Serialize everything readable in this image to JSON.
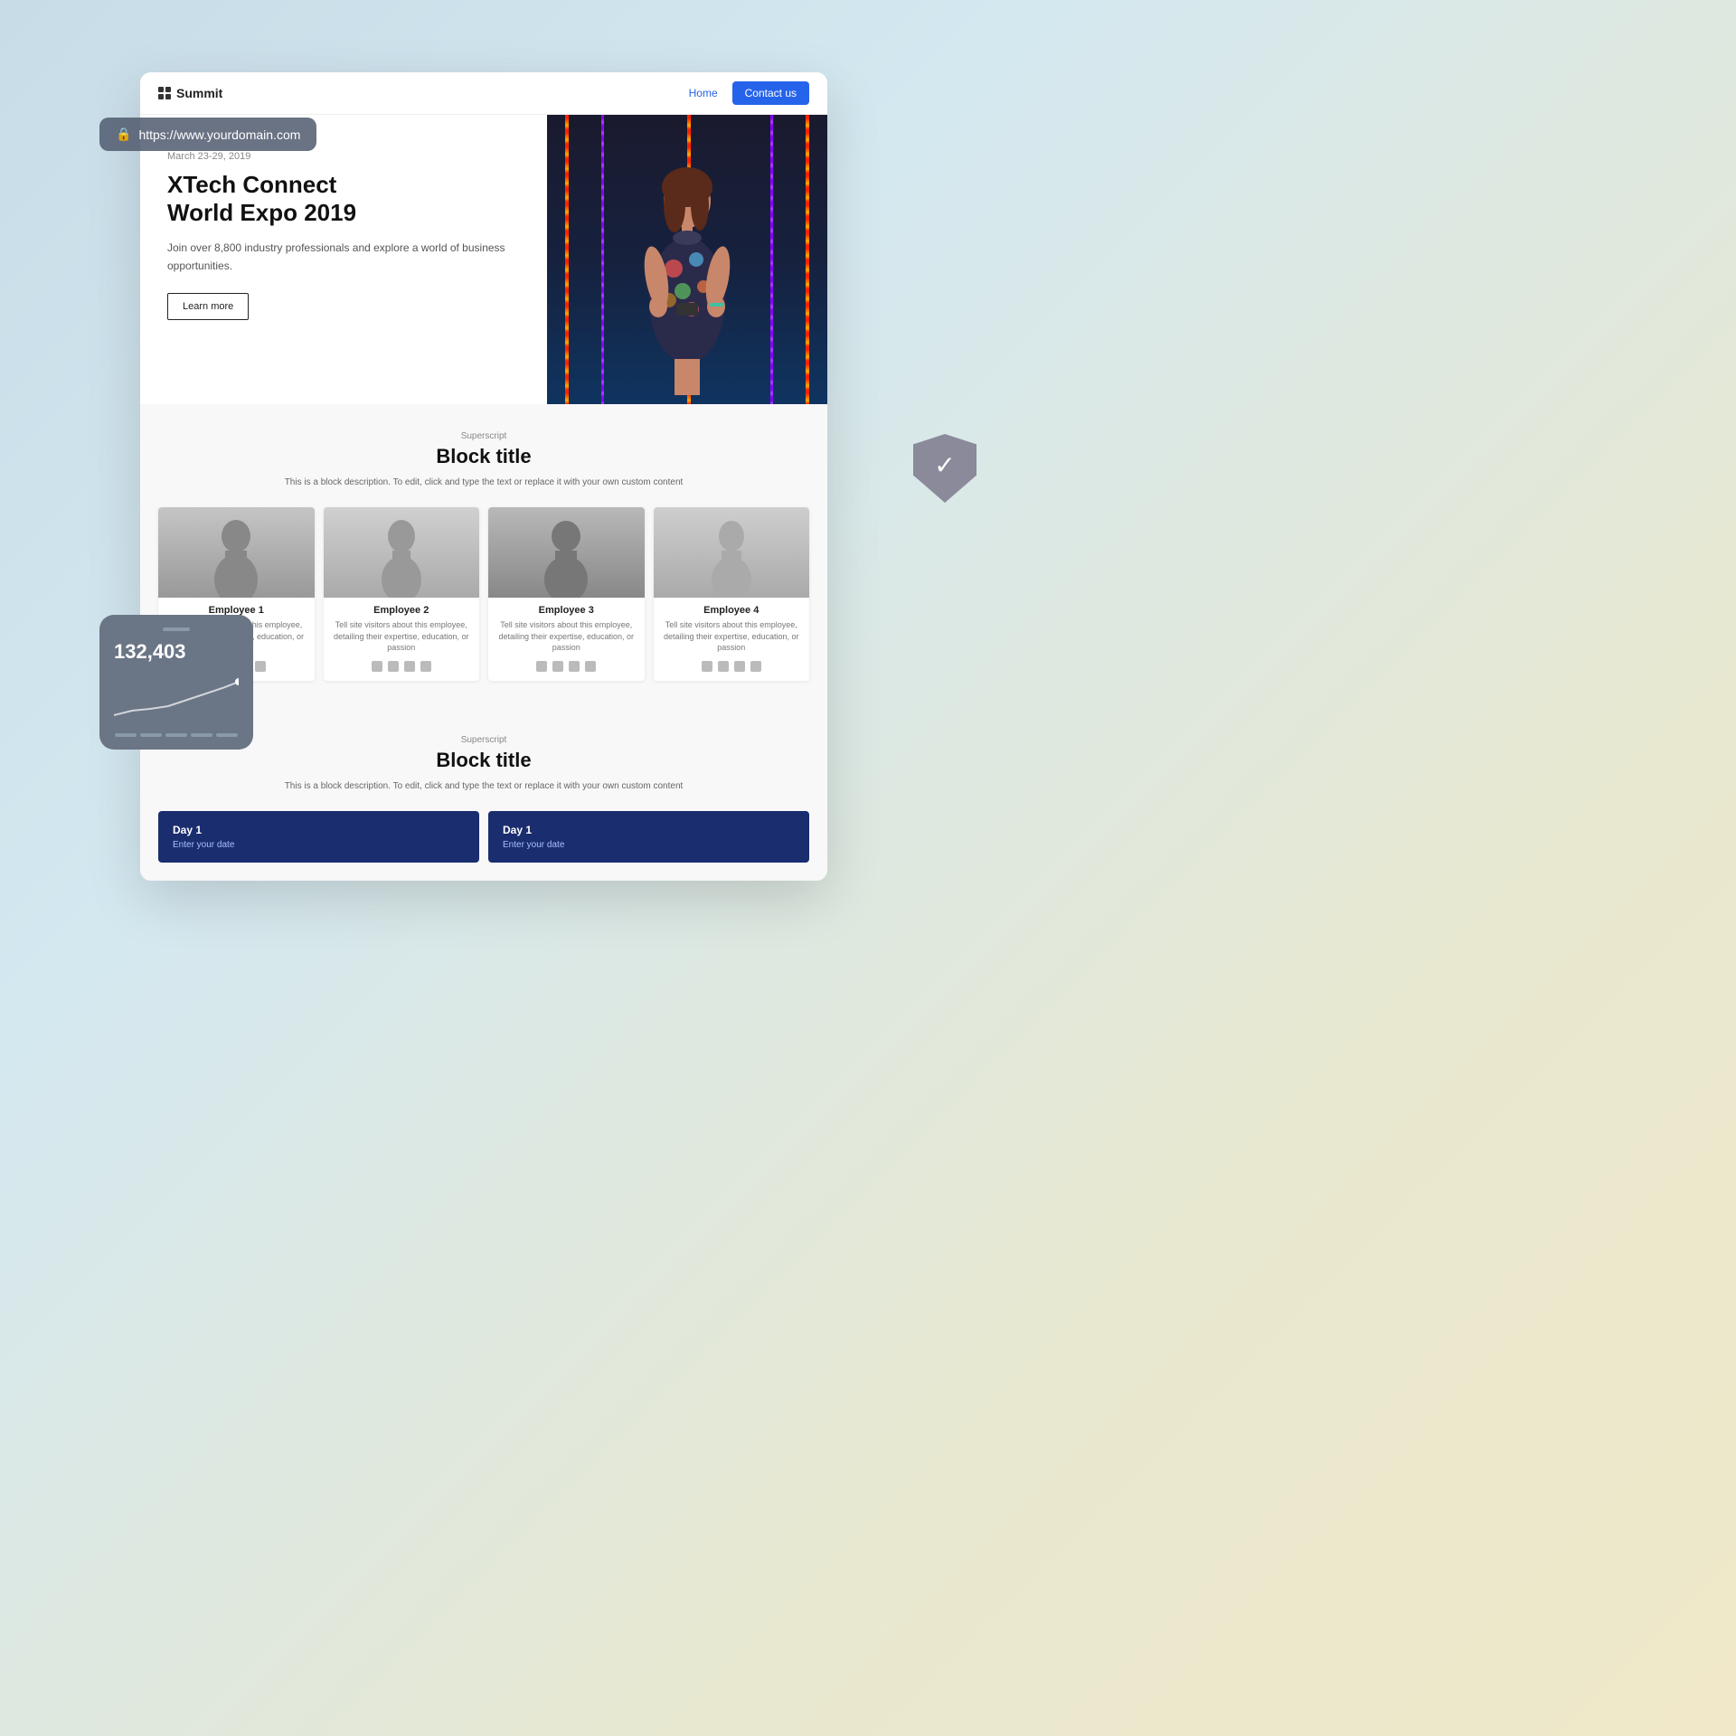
{
  "page": {
    "background": "gradient",
    "url": "https://www.yourdomain.com"
  },
  "nav": {
    "logo_text": "Summit",
    "home_link": "Home",
    "contact_btn": "Contact us"
  },
  "hero": {
    "date": "March 23-29, 2019",
    "title_line1": "XTech Connect",
    "title_line2": "World Expo 2019",
    "description": "Join over 8,800 industry professionals and explore a world of business opportunities.",
    "cta_btn": "Learn more"
  },
  "section1": {
    "superscript": "Superscript",
    "block_title": "Block title",
    "block_desc": "This is a block description. To edit, click and type the text or replace it with your own custom content"
  },
  "employees": [
    {
      "name": "Employee 1",
      "desc": "Tell site visitors about this employee, detailing their expertise, education, or passion"
    },
    {
      "name": "Employee 2",
      "desc": "Tell site visitors about this employee, detailing their expertise, education, or passion"
    },
    {
      "name": "Employee 3",
      "desc": "Tell site visitors about this employee, detailing their expertise, education, or passion"
    },
    {
      "name": "Employee 4",
      "desc": "Tell site visitors about this employee, detailing their expertise, education, or passion"
    }
  ],
  "section2": {
    "superscript": "Superscript",
    "block_title": "Block title",
    "block_desc": "This is a block description. To edit, click and type the text or replace it with your own custom content"
  },
  "schedule": [
    {
      "day": "Day 1",
      "date_label": "Enter your date"
    },
    {
      "day": "Day 1",
      "date_label": "Enter your date"
    }
  ],
  "stats_widget": {
    "number": "132,403"
  }
}
